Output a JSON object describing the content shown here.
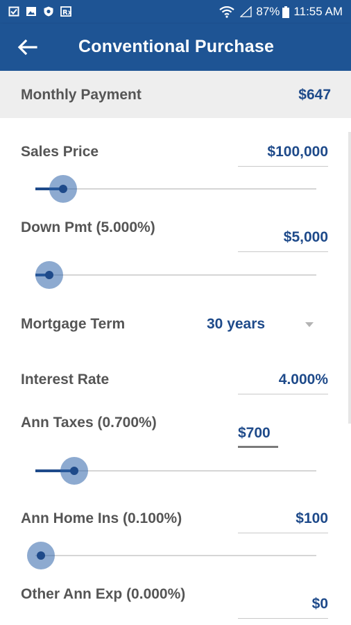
{
  "status_bar": {
    "battery": "87%",
    "time": "11:55 AM"
  },
  "header": {
    "title": "Conventional Purchase"
  },
  "summary": {
    "label": "Monthly Payment",
    "value": "$647"
  },
  "fields": {
    "sales_price": {
      "label": "Sales Price",
      "value": "$100,000",
      "slider_level": 0.1
    },
    "down_pmt": {
      "label": "Down Pmt (5.000%)",
      "value": "$5,000",
      "slider_level": 0.05
    },
    "mortgage_term": {
      "label": "Mortgage Term",
      "value": "30 years"
    },
    "interest_rate": {
      "label": "Interest Rate",
      "value": "4.000%"
    },
    "ann_taxes": {
      "label": "Ann Taxes (0.700%)",
      "value": "$700",
      "slider_level": 0.14
    },
    "ann_home_ins": {
      "label": "Ann Home Ins (0.100%)",
      "value": "$100",
      "slider_level": 0.02
    },
    "other_ann_exp": {
      "label": "Other Ann Exp (0.000%)",
      "value": "$0"
    }
  },
  "colors": {
    "primary": "#1e5494",
    "value_text": "#1e4a8a",
    "label_text": "#555555",
    "summary_bg": "#eeeeee"
  },
  "icons": {
    "status_left": [
      "task-icon",
      "gallery-icon",
      "shield-icon",
      "rx-icon"
    ],
    "status_right": [
      "wifi-icon",
      "signal-icon",
      "battery-icon"
    ],
    "back": "back-arrow-icon",
    "dropdown": "chevron-down-icon"
  }
}
